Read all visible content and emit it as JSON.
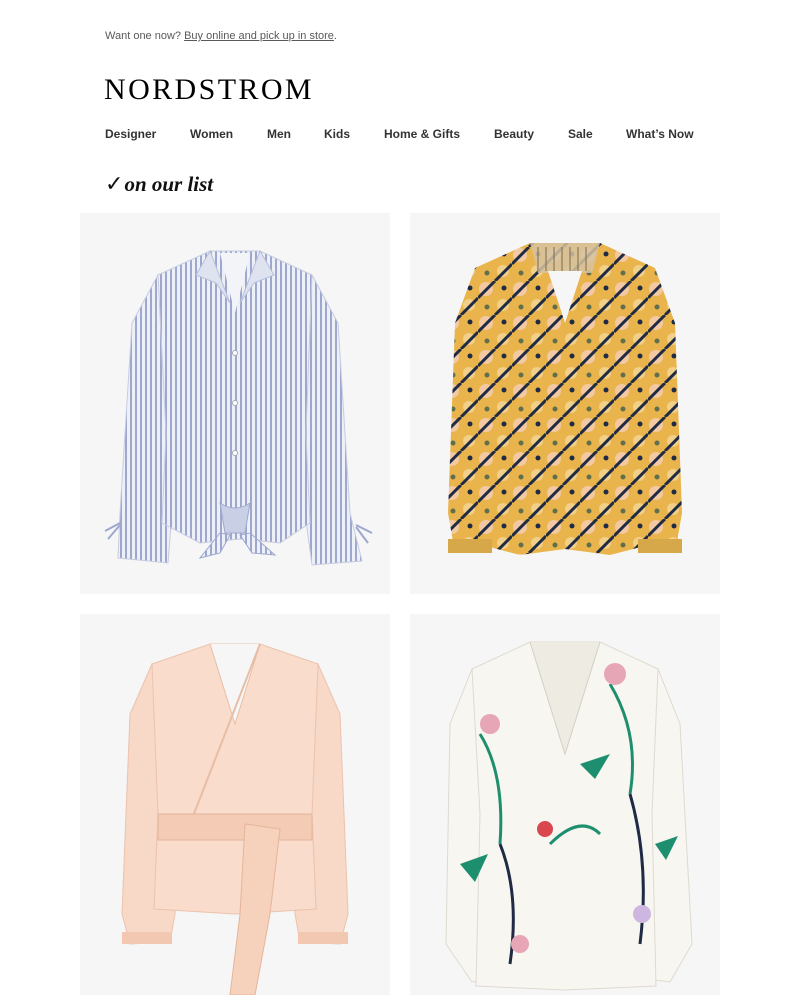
{
  "preheader": {
    "text": "Want one now? ",
    "link": "Buy online and pick up in store",
    "suffix": "."
  },
  "brand": {
    "logo": "NORDSTROM"
  },
  "nav": {
    "items": [
      "Designer",
      "Women",
      "Men",
      "Kids",
      "Home & Gifts",
      "Beauty",
      "Sale",
      "What’s Now"
    ]
  },
  "section": {
    "check": "✓",
    "title": "on our list"
  },
  "products": [
    {
      "image": "striped-tie-front-blouse",
      "color": "#b7bfd9"
    },
    {
      "image": "floral-print-peasant-blouse",
      "color": "#e2b04a"
    },
    {
      "image": "blush-wrap-blouse",
      "color": "#f8d6c4"
    },
    {
      "image": "white-floral-print-blouse",
      "color": "#f4f1ea"
    }
  ],
  "colors": {
    "background": "#ffffff",
    "tile_background": "#f6f6f6",
    "text": "#000000",
    "muted_text": "#595959"
  }
}
